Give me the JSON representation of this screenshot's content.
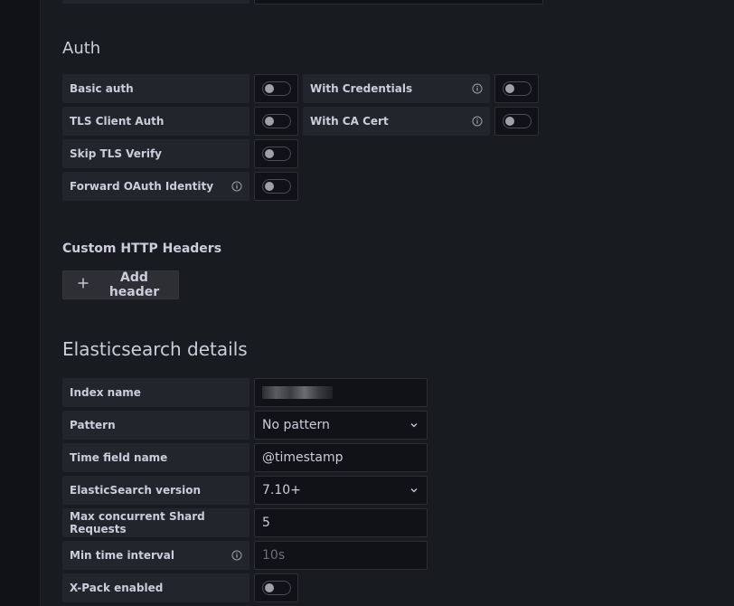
{
  "auth": {
    "title": "Auth",
    "basic_auth": "Basic auth",
    "with_credentials": "With Credentials",
    "tls_client_auth": "TLS Client Auth",
    "with_ca_cert": "With CA Cert",
    "skip_tls_verify": "Skip TLS Verify",
    "forward_oauth": "Forward OAuth Identity"
  },
  "headers": {
    "title": "Custom HTTP Headers",
    "add_label": "Add header"
  },
  "es": {
    "title": "Elasticsearch details",
    "index_name_label": "Index name",
    "pattern_label": "Pattern",
    "pattern_value": "No pattern",
    "time_field_label": "Time field name",
    "time_field_value": "@timestamp",
    "version_label": "ElasticSearch version",
    "version_value": "7.10+",
    "max_shard_label": "Max concurrent Shard Requests",
    "max_shard_value": "5",
    "min_interval_label": "Min time interval",
    "min_interval_placeholder": "10s",
    "xpack_label": "X-Pack enabled"
  },
  "colors": {
    "background": "#181b1f",
    "label_bg": "#22252b",
    "input_bg": "#111217",
    "text": "#ccccdc"
  }
}
